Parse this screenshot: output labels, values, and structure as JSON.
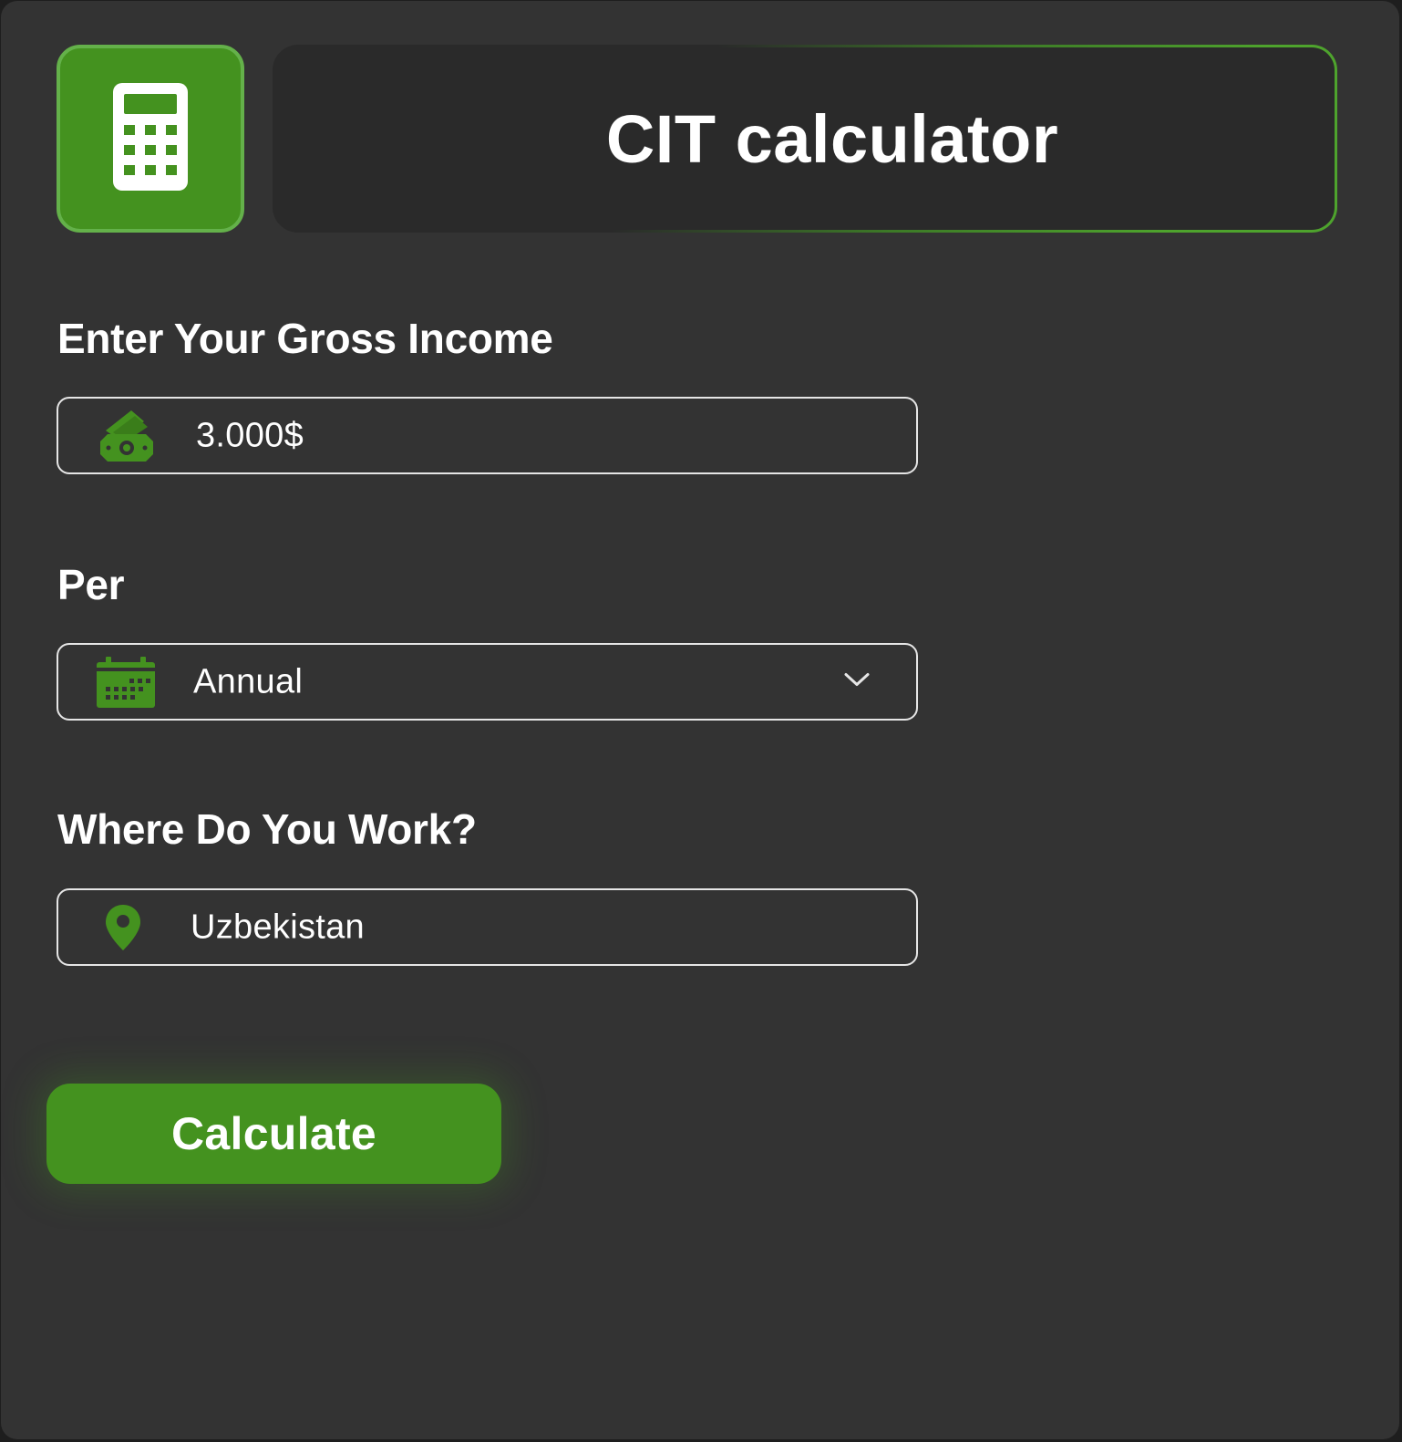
{
  "header": {
    "title": "CIT calculator",
    "logo_icon": "calculator-icon"
  },
  "colors": {
    "accent": "#44921f",
    "accent_border": "#64b14a",
    "panel_bg": "#333333",
    "title_bg": "#2a2a2a",
    "field_border": "#e6e6e6",
    "text": "#ffffff"
  },
  "income": {
    "label": "Enter Your Gross Income",
    "value": "3.000$",
    "icon": "money-icon"
  },
  "period": {
    "label": "Per",
    "selected": "Annual",
    "icon": "calendar-icon",
    "dropdown_icon": "chevron-down-icon"
  },
  "location": {
    "label": "Where Do You Work?",
    "value": "Uzbekistan",
    "icon": "location-pin-icon"
  },
  "actions": {
    "calculate_label": "Calculate"
  }
}
